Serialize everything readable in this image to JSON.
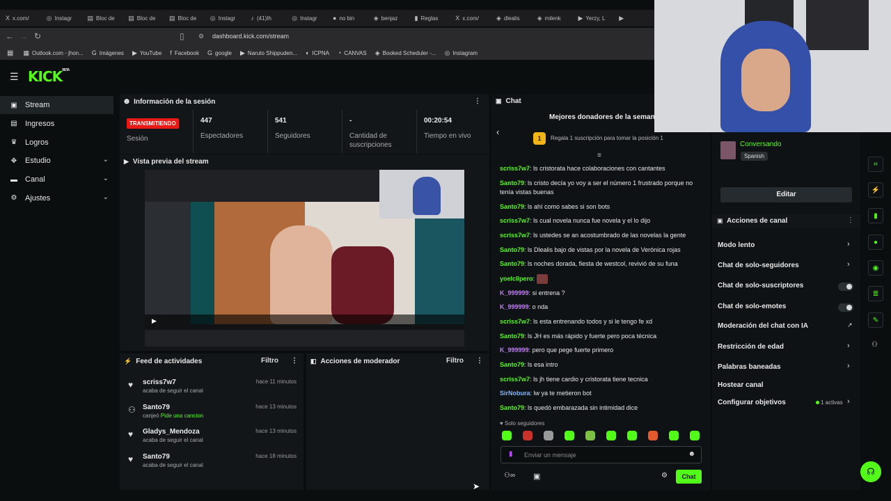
{
  "browser": {
    "tabs": [
      {
        "icon": "X",
        "label": "x.com/"
      },
      {
        "icon": "◎",
        "label": "Instagr"
      },
      {
        "icon": "▤",
        "label": "Bloc de"
      },
      {
        "icon": "▤",
        "label": "Bloc de"
      },
      {
        "icon": "▤",
        "label": "Bloc de"
      },
      {
        "icon": "◎",
        "label": "Instagr"
      },
      {
        "icon": "♪",
        "label": "(41)Ih"
      },
      {
        "icon": "◎",
        "label": "Instagr"
      },
      {
        "icon": "●",
        "label": "no bin"
      },
      {
        "icon": "◈",
        "label": "benjaz"
      },
      {
        "icon": "▮",
        "label": "Reglas"
      },
      {
        "icon": "X",
        "label": "x.com/"
      },
      {
        "icon": "◈",
        "label": "dlealis"
      },
      {
        "icon": "◈",
        "label": "milenk"
      },
      {
        "icon": "▶",
        "label": "Yerzy, L"
      },
      {
        "icon": "▶",
        "label": ""
      }
    ],
    "url": "dashboard.kick.com/stream",
    "bookmarks": [
      {
        "icon": "▦",
        "label": "Outlook.com - jhon..."
      },
      {
        "icon": "G",
        "label": "Imágenes"
      },
      {
        "icon": "▶",
        "label": "YouTube"
      },
      {
        "icon": "f",
        "label": "Facebook"
      },
      {
        "icon": "G",
        "label": "google"
      },
      {
        "icon": "▶",
        "label": "Naruto Shippuden..."
      },
      {
        "icon": "◐",
        "label": "ICPNA"
      },
      {
        "icon": "◔",
        "label": "CANVAS"
      },
      {
        "icon": "◈",
        "label": "Booked Scheduler -..."
      },
      {
        "icon": "◎",
        "label": "Instagram"
      }
    ]
  },
  "brand": {
    "logo": "KICK",
    "beta": "BETA",
    "accent": "#53fc18"
  },
  "sidebar": {
    "items": [
      {
        "label": "Stream",
        "icon": "stream-icon",
        "glyph": "▣",
        "active": true
      },
      {
        "label": "Ingresos",
        "icon": "income-icon",
        "glyph": "▤"
      },
      {
        "label": "Logros",
        "icon": "trophy-icon",
        "glyph": "♛"
      },
      {
        "label": "Estudio",
        "icon": "studio-icon",
        "glyph": "✥",
        "chev": true
      },
      {
        "label": "Canal",
        "icon": "channel-icon",
        "glyph": "▬",
        "chev": true
      },
      {
        "label": "Ajustes",
        "icon": "gear-icon",
        "glyph": "⚙",
        "chev": true
      }
    ]
  },
  "session": {
    "title": "Información de la sesión",
    "live_badge": "TRANSMITIENDO",
    "live_label": "Sesión",
    "stats": [
      {
        "value": "447",
        "label": "Espectadores"
      },
      {
        "value": "541",
        "label": "Seguidores"
      },
      {
        "value": "-",
        "label": "Cantidad de suscripciones"
      },
      {
        "value": "00:20:54",
        "label": "Tiempo en vivo"
      }
    ]
  },
  "preview": {
    "title": "Vista previa del stream"
  },
  "feed": {
    "title": "Feed de actividades",
    "filter": "Filtro",
    "items": [
      {
        "name": "scriss7w7",
        "text": "acaba de seguir el canal",
        "highlight": "",
        "time": "hace 11 minutos",
        "icon": "heart"
      },
      {
        "name": "Santo79",
        "text": "canjeó ",
        "highlight": "Pide una cancion",
        "time": "hace 13 minutos",
        "icon": "redeem"
      },
      {
        "name": "Gladys_Mendoza",
        "text": "acaba de seguir el canal",
        "highlight": "",
        "time": "hace 13 minutos",
        "icon": "heart"
      },
      {
        "name": "Santo79",
        "text": "acaba de seguir el canal",
        "highlight": "",
        "time": "hace 18 minutos",
        "icon": "heart"
      }
    ]
  },
  "mod": {
    "title": "Acciones de moderador",
    "filter": "Filtro"
  },
  "chat": {
    "title": "Chat",
    "donors_title": "Mejores donadores de la semana",
    "donor_rank": "1",
    "donor_hint": "Regala 1 suscripción para tomar la posición 1",
    "messages": [
      {
        "user": "scriss7w7",
        "color": "u-g",
        "text": "ls cristorata hace colaboraciones con cantantes"
      },
      {
        "user": "Santo79",
        "color": "u-g",
        "text": "ls cristo decía yo voy a ser el número 1 frustrado porque no tenía vistas buenas"
      },
      {
        "user": "Santo79",
        "color": "u-g",
        "text": "ls ahí como sabes si son bots"
      },
      {
        "user": "scriss7w7",
        "color": "u-g",
        "text": "ls cual novela nunca fue novela y el lo dijo"
      },
      {
        "user": "scriss7w7",
        "color": "u-g",
        "text": "ls ustedes se an acostumbrado de las novelas la gente"
      },
      {
        "user": "Santo79",
        "color": "u-g",
        "text": "ls Dlealis bajo de vistas por la novela de Verónica rojas"
      },
      {
        "user": "Santo79",
        "color": "u-g",
        "text": "ls noches dorada, fiesta de westcol, revivió de su funa"
      },
      {
        "user": "yoelclipero",
        "color": "u-g",
        "text": ""
      },
      {
        "user": "K_999999",
        "color": "u-p",
        "text": "si entrena ?"
      },
      {
        "user": "K_999999",
        "color": "u-p",
        "text": "o nda"
      },
      {
        "user": "scriss7w7",
        "color": "u-g",
        "text": "ls esta entrenando todos y si le tengo fe xd"
      },
      {
        "user": "Santo79",
        "color": "u-g",
        "text": "ls JH es más rápido y fuerte pero poca técnica"
      },
      {
        "user": "K_999999",
        "color": "u-p",
        "text": "pero que pege fuerte primero"
      },
      {
        "user": "Santo79",
        "color": "u-g",
        "text": "ls esa intro"
      },
      {
        "user": "scriss7w7",
        "color": "u-g",
        "text": "ls jh tiene cardio y cristorata tiene tecnica"
      },
      {
        "user": "SirNobura",
        "color": "u-b",
        "text": "lw ya te metieron bot"
      },
      {
        "user": "Santo79",
        "color": "u-g",
        "text": "ls quedó embarazada sin intimidad dice"
      }
    ],
    "followers_only": "Solo seguidores",
    "input_placeholder": "Enviar un mensaje",
    "send_label": "Chat"
  },
  "channel": {
    "status": "Conversando",
    "language": "Spanish",
    "edit_label": "Editar",
    "actions_title": "Acciones de canal",
    "actions": [
      {
        "label": "Modo lento",
        "type": "chev"
      },
      {
        "label": "Chat de solo-seguidores",
        "type": "chev"
      },
      {
        "label": "Chat de solo-suscriptores",
        "type": "toggle"
      },
      {
        "label": "Chat de solo-emotes",
        "type": "toggle"
      },
      {
        "label": "Moderación del chat con IA",
        "type": "ext"
      },
      {
        "label": "Restricción de edad",
        "type": "chev"
      },
      {
        "label": "Palabras baneadas",
        "type": "chev"
      },
      {
        "label": "Hostear canal",
        "type": "none"
      },
      {
        "label": "Configurar objetivos",
        "type": "chev",
        "extra": "1 activas"
      }
    ]
  }
}
